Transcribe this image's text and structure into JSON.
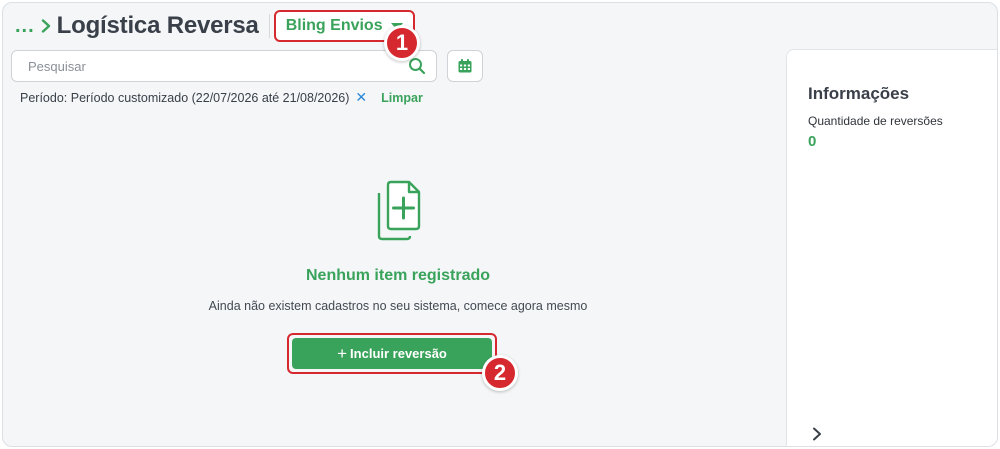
{
  "header": {
    "breadcrumb_ellipsis": "...",
    "title": "Logística Reversa",
    "account_dropdown": "Bling Envios"
  },
  "search": {
    "placeholder": "Pesquisar",
    "value": ""
  },
  "filter": {
    "text": "Período: Período customizado (22/07/2026 até 21/08/2026)",
    "remove_symbol": "✕",
    "clear_label": "Limpar"
  },
  "empty_state": {
    "icon": "add-document-icon",
    "title": "Nenhum item registrado",
    "subtitle": "Ainda não existem cadastros no seu sistema, comece agora mesmo"
  },
  "cta": {
    "icon": "plus",
    "label": "Incluir reversão"
  },
  "info_panel": {
    "title": "Informações",
    "metric_label": "Quantidade de reversões",
    "metric_value": "0"
  },
  "annotations": {
    "badge_1": "1",
    "badge_2": "2"
  },
  "colors": {
    "accent_green": "#3aa35b",
    "highlight_red": "#d6292f",
    "link_blue": "#2c88d9"
  }
}
